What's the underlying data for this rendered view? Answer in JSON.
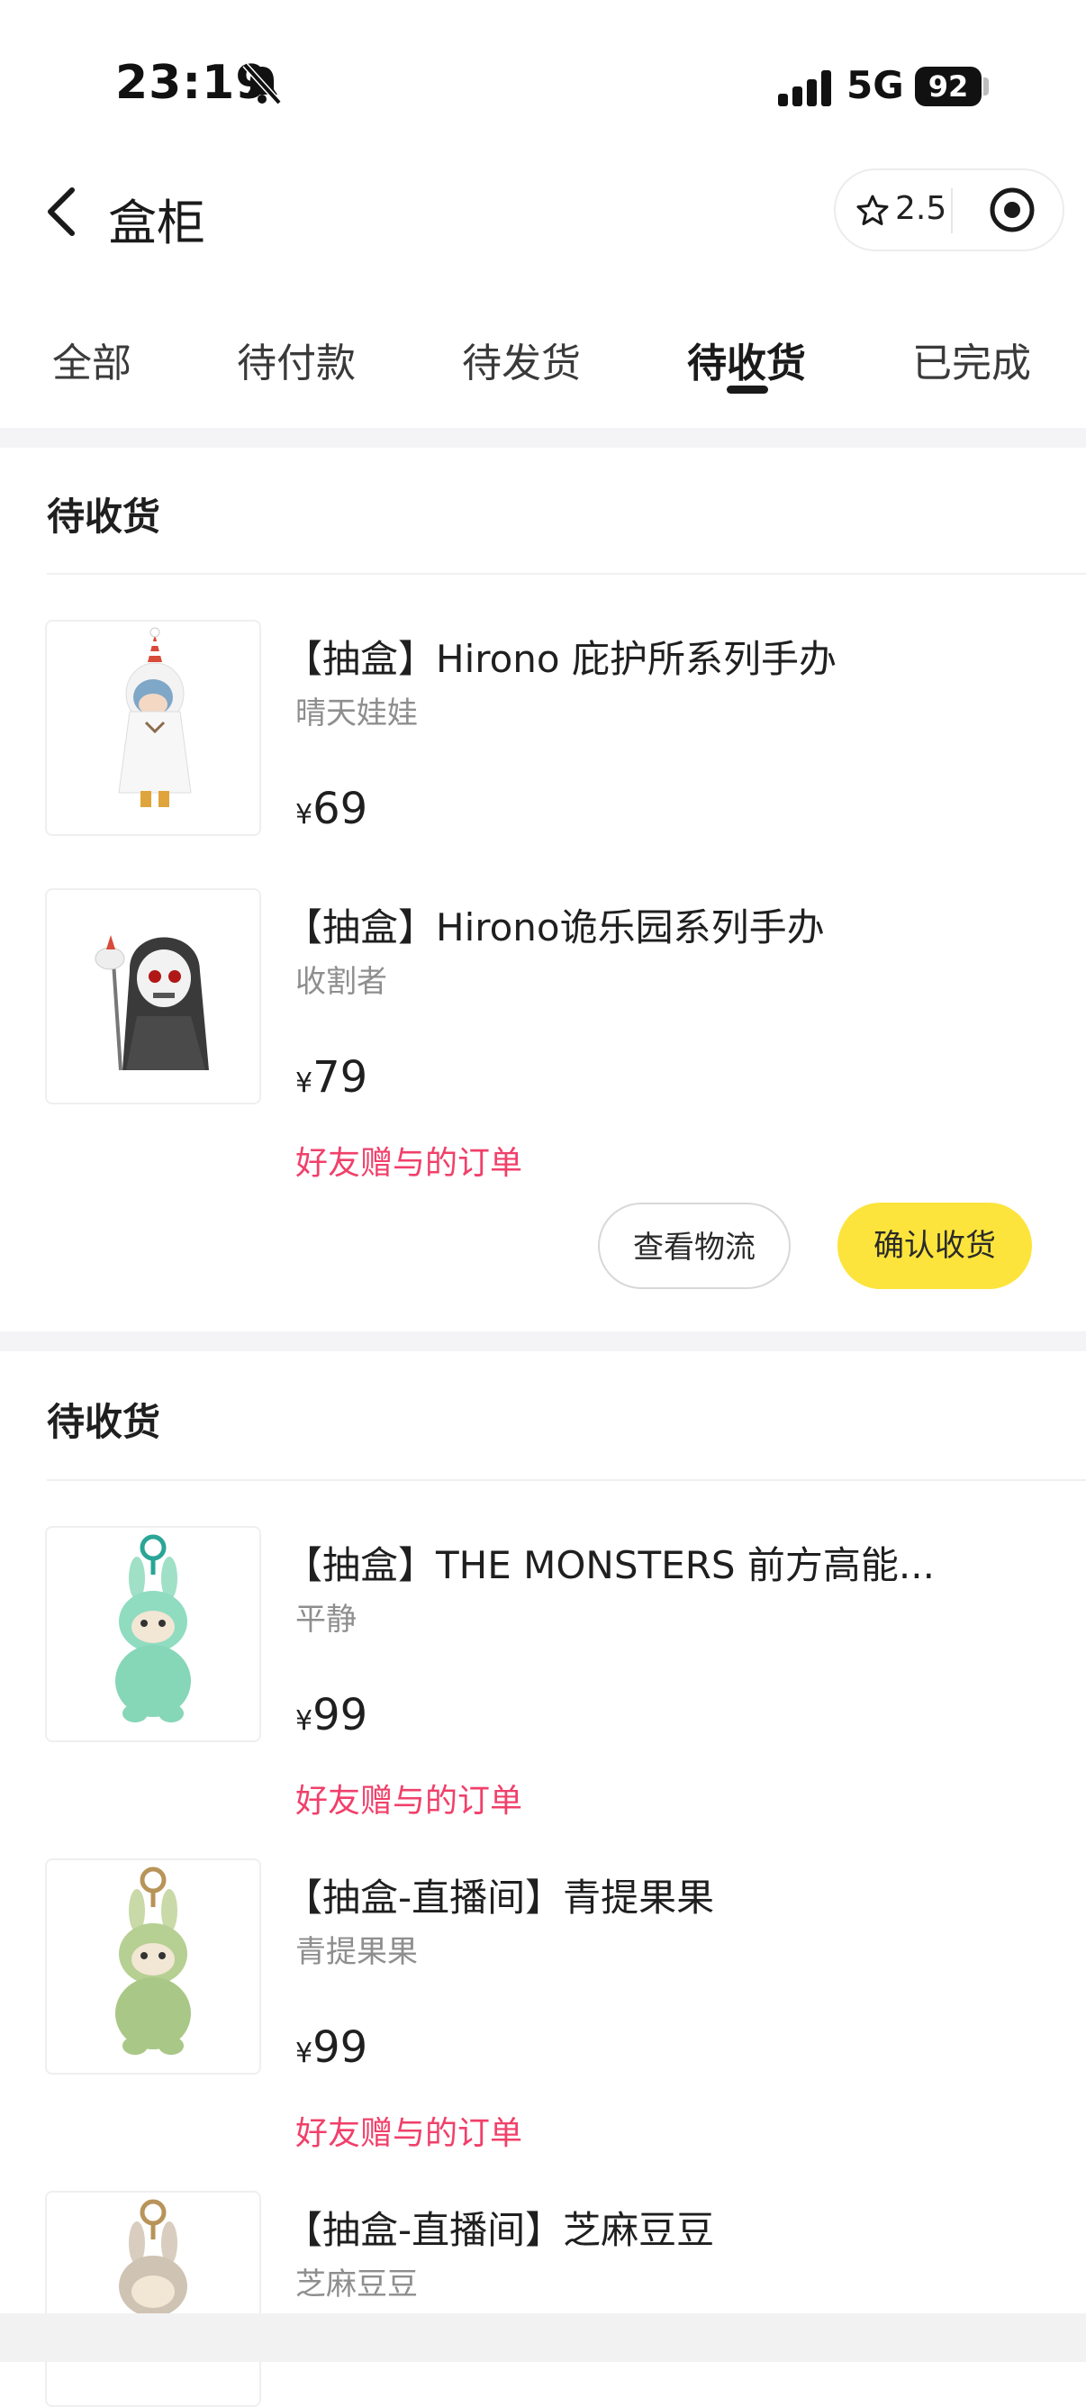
{
  "status_bar": {
    "time": "23:19",
    "network": "5G",
    "battery": "92"
  },
  "nav": {
    "title": "盒柜",
    "capsule_value": "2.5"
  },
  "tabs": [
    {
      "label": "全部"
    },
    {
      "label": "待付款"
    },
    {
      "label": "待发货"
    },
    {
      "label": "待收货",
      "active": true
    },
    {
      "label": "已完成"
    }
  ],
  "currency": "¥",
  "orders": [
    {
      "status": "待收货",
      "items": [
        {
          "name": "【抽盒】Hirono 庇护所系列手办",
          "variant": "晴天娃娃",
          "price": "69"
        },
        {
          "name": "【抽盒】Hirono诡乐园系列手办",
          "variant": "收割者",
          "price": "79",
          "note": "好友赠与的订单"
        }
      ],
      "actions": {
        "logistics": "查看物流",
        "confirm": "确认收货"
      }
    },
    {
      "status": "待收货",
      "items": [
        {
          "name": "【抽盒】THE MONSTERS 前方高能...",
          "variant": "平静",
          "price": "99",
          "note": "好友赠与的订单"
        },
        {
          "name": "【抽盒-直播间】青提果果",
          "variant": "青提果果",
          "price": "99",
          "note": "好友赠与的订单"
        },
        {
          "name": "【抽盒-直播间】芝麻豆豆",
          "variant": "芝麻豆豆"
        }
      ]
    }
  ],
  "colors": {
    "accent_yellow": "#fce43c",
    "gift_text": "#f0406a",
    "muted_text": "#8e8e8e"
  },
  "icons": [
    "bell-muted-icon",
    "signal-icon",
    "back-icon",
    "star-icon",
    "target-icon"
  ]
}
